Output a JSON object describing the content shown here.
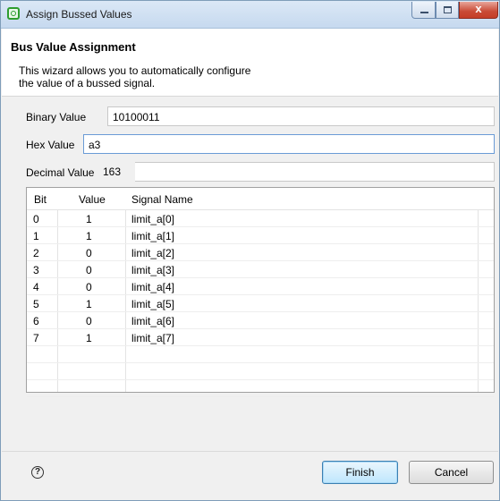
{
  "window": {
    "title": "Assign Bussed Values",
    "controls": {
      "minimize": "minimize",
      "maximize": "maximize",
      "close": "x"
    }
  },
  "header": {
    "title": "Bus Value Assignment",
    "description_line1": "This wizard allows you to automatically configure",
    "description_line2": "the value of a bussed signal."
  },
  "form": {
    "binary": {
      "label": "Binary Value",
      "value": "10100011"
    },
    "hex": {
      "label": "Hex Value",
      "value": "a3"
    },
    "decimal": {
      "label": "Decimal Value",
      "value": "163"
    }
  },
  "table": {
    "headers": {
      "bit": "Bit",
      "value": "Value",
      "signal": "Signal Name"
    },
    "rows": [
      {
        "bit": "0",
        "value": "1",
        "signal": "limit_a[0]"
      },
      {
        "bit": "1",
        "value": "1",
        "signal": "limit_a[1]"
      },
      {
        "bit": "2",
        "value": "0",
        "signal": "limit_a[2]"
      },
      {
        "bit": "3",
        "value": "0",
        "signal": "limit_a[3]"
      },
      {
        "bit": "4",
        "value": "0",
        "signal": "limit_a[4]"
      },
      {
        "bit": "5",
        "value": "1",
        "signal": "limit_a[5]"
      },
      {
        "bit": "6",
        "value": "0",
        "signal": "limit_a[6]"
      },
      {
        "bit": "7",
        "value": "1",
        "signal": "limit_a[7]"
      }
    ]
  },
  "footer": {
    "help_icon": "help-icon",
    "finish_label": "Finish",
    "cancel_label": "Cancel"
  }
}
